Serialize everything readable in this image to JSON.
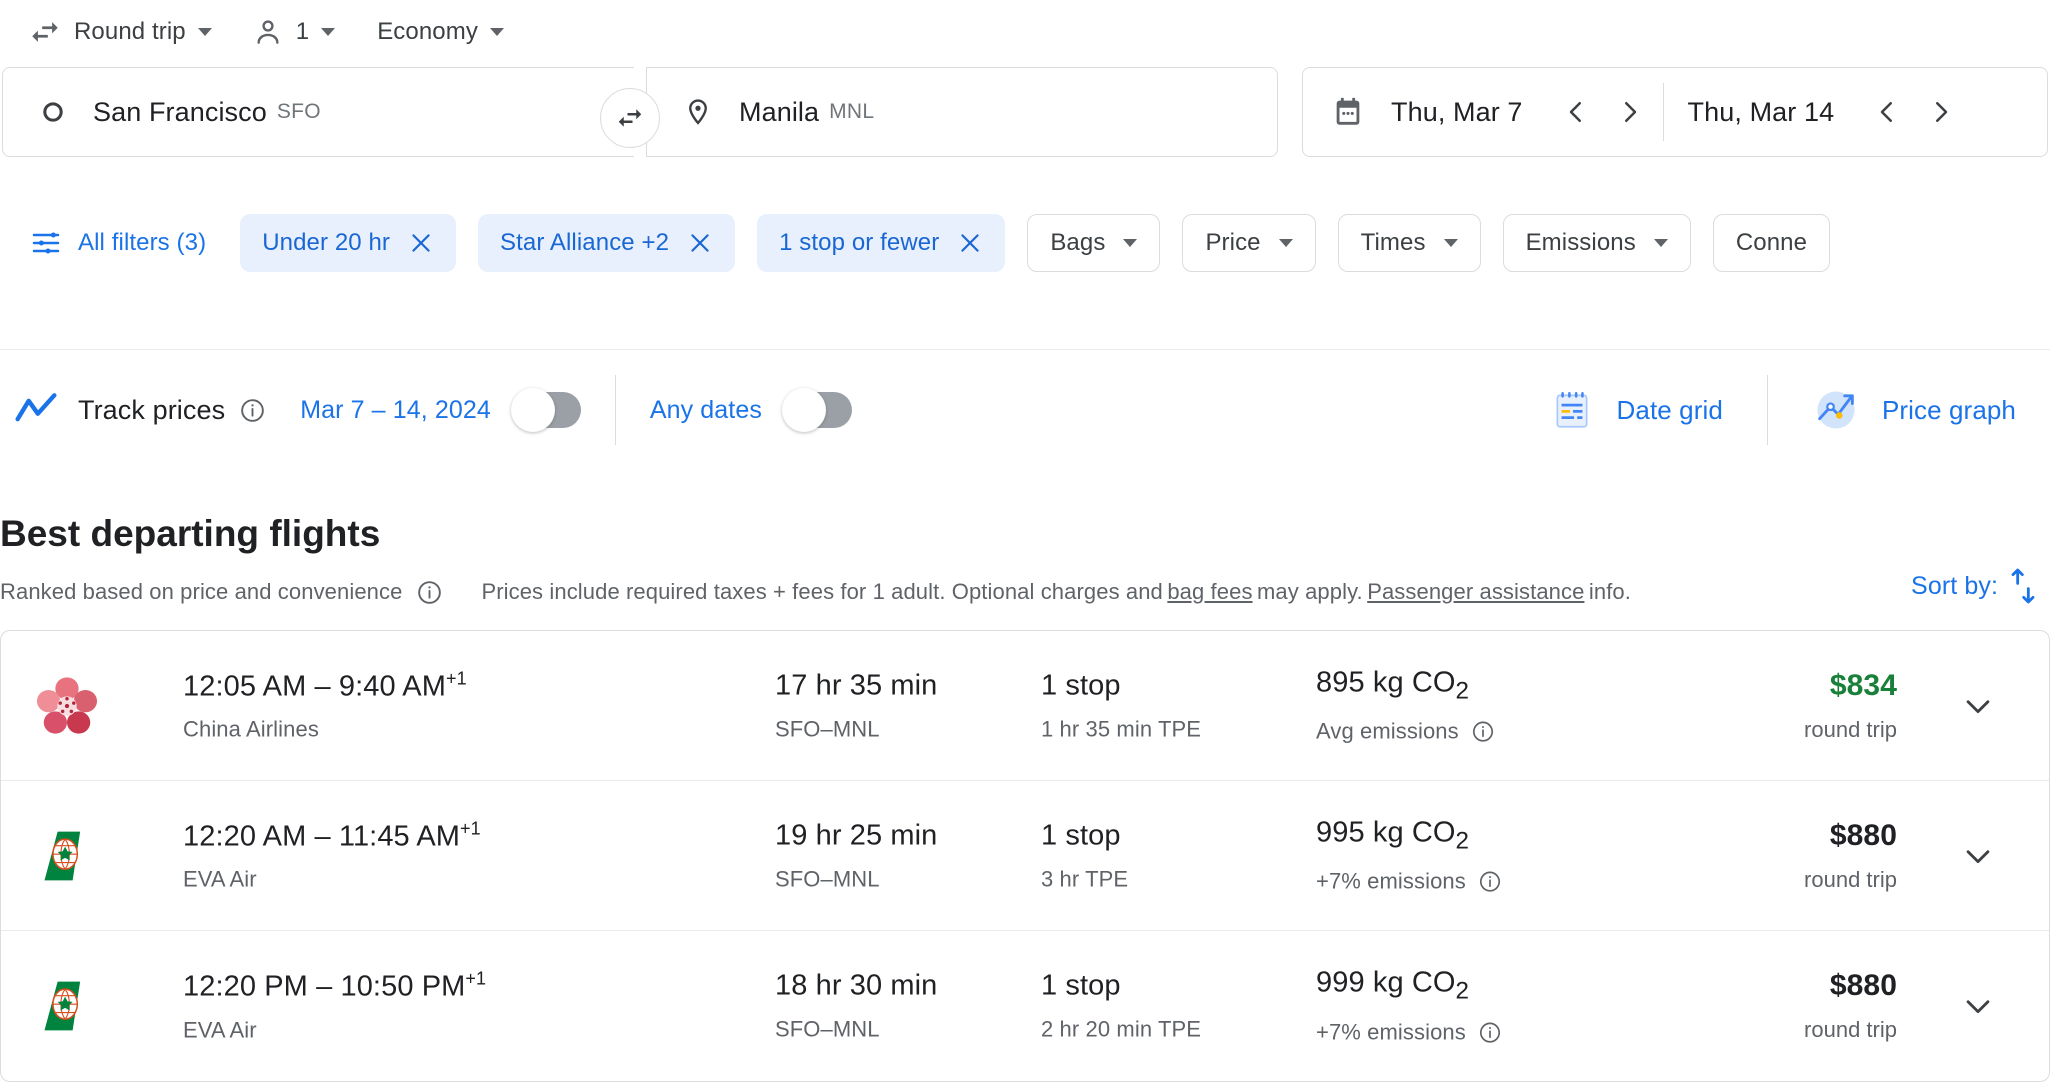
{
  "trip_options": {
    "trip_type": "Round trip",
    "passengers": "1",
    "cabin_class": "Economy"
  },
  "search": {
    "origin_city": "San Francisco",
    "origin_code": "SFO",
    "destination_city": "Manila",
    "destination_code": "MNL",
    "depart_date": "Thu, Mar 7",
    "return_date": "Thu, Mar 14"
  },
  "filters": {
    "all_filters_label": "All filters (3)",
    "active_chips": [
      {
        "label": "Under 20 hr"
      },
      {
        "label": "Star Alliance +2"
      },
      {
        "label": "1 stop or fewer"
      }
    ],
    "dropdown_chips": [
      {
        "label": "Bags"
      },
      {
        "label": "Price"
      },
      {
        "label": "Times"
      },
      {
        "label": "Emissions"
      },
      {
        "label": "Conne"
      }
    ]
  },
  "track": {
    "title": "Track prices",
    "date_range_label": "Mar 7 – 14, 2024",
    "any_dates_label": "Any dates",
    "date_range_toggle_on": false,
    "any_dates_toggle_on": false,
    "date_grid_label": "Date grid",
    "price_graph_label": "Price graph"
  },
  "results_header": {
    "title": "Best departing flights",
    "ranked_note": "Ranked based on price and convenience",
    "prices_note_1": "Prices include required taxes + fees for 1 adult. Optional charges and",
    "bag_fees_link": "bag fees",
    "prices_note_2": "may apply.",
    "passenger_assistance_link": "Passenger assistance",
    "prices_note_3": "info.",
    "sort_by_label": "Sort by:"
  },
  "colors": {
    "accent_blue": "#1a73e8",
    "chip_active_bg": "#e8f0fe",
    "chip_active_text": "#1967d2",
    "price_green": "#188038",
    "text_primary": "#202124",
    "text_secondary": "#5f6368"
  },
  "flights": [
    {
      "airline_logo": "china-airlines-plum-blossom-logo",
      "times": "12:05 AM – 9:40 AM",
      "day_offset": "+1",
      "airline": "China Airlines",
      "duration": "17 hr 35 min",
      "route": "SFO–MNL",
      "stops": "1 stop",
      "layover": "1 hr 35 min TPE",
      "emissions": "895 kg CO",
      "emissions_sub": "2",
      "emissions_note": "Avg emissions",
      "price": "$834",
      "price_note": "round trip",
      "price_is_low": true
    },
    {
      "airline_logo": "eva-air-tailfin-logo",
      "times": "12:20 AM – 11:45 AM",
      "day_offset": "+1",
      "airline": "EVA Air",
      "duration": "19 hr 25 min",
      "route": "SFO–MNL",
      "stops": "1 stop",
      "layover": "3 hr TPE",
      "emissions": "995 kg CO",
      "emissions_sub": "2",
      "emissions_note": "+7% emissions",
      "price": "$880",
      "price_note": "round trip",
      "price_is_low": false
    },
    {
      "airline_logo": "eva-air-tailfin-logo",
      "times": "12:20 PM – 10:50 PM",
      "day_offset": "+1",
      "airline": "EVA Air",
      "duration": "18 hr 30 min",
      "route": "SFO–MNL",
      "stops": "1 stop",
      "layover": "2 hr 20 min TPE",
      "emissions": "999 kg CO",
      "emissions_sub": "2",
      "emissions_note": "+7% emissions",
      "price": "$880",
      "price_note": "round trip",
      "price_is_low": false
    }
  ]
}
